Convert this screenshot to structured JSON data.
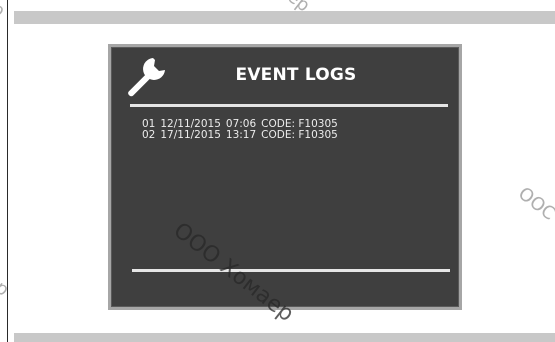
{
  "screen": {
    "title": "EVENT LOGS",
    "icon": "wrench-icon",
    "logs": [
      {
        "index": "01",
        "date": "12/11/2015",
        "time": "07:06",
        "code": "CODE: F10305"
      },
      {
        "index": "02",
        "date": "17/11/2015",
        "time": "13:17",
        "code": "CODE: F10305"
      }
    ]
  },
  "watermark": {
    "center": "ООО Хомаер",
    "top_left": "p",
    "top_center": "ер",
    "right": "ООС",
    "bottom_left": "р"
  },
  "colors": {
    "screen_background": "#3f3f3f",
    "screen_border": "#a6a6a6",
    "text": "#ffffff",
    "band": "#c8c8c8"
  }
}
